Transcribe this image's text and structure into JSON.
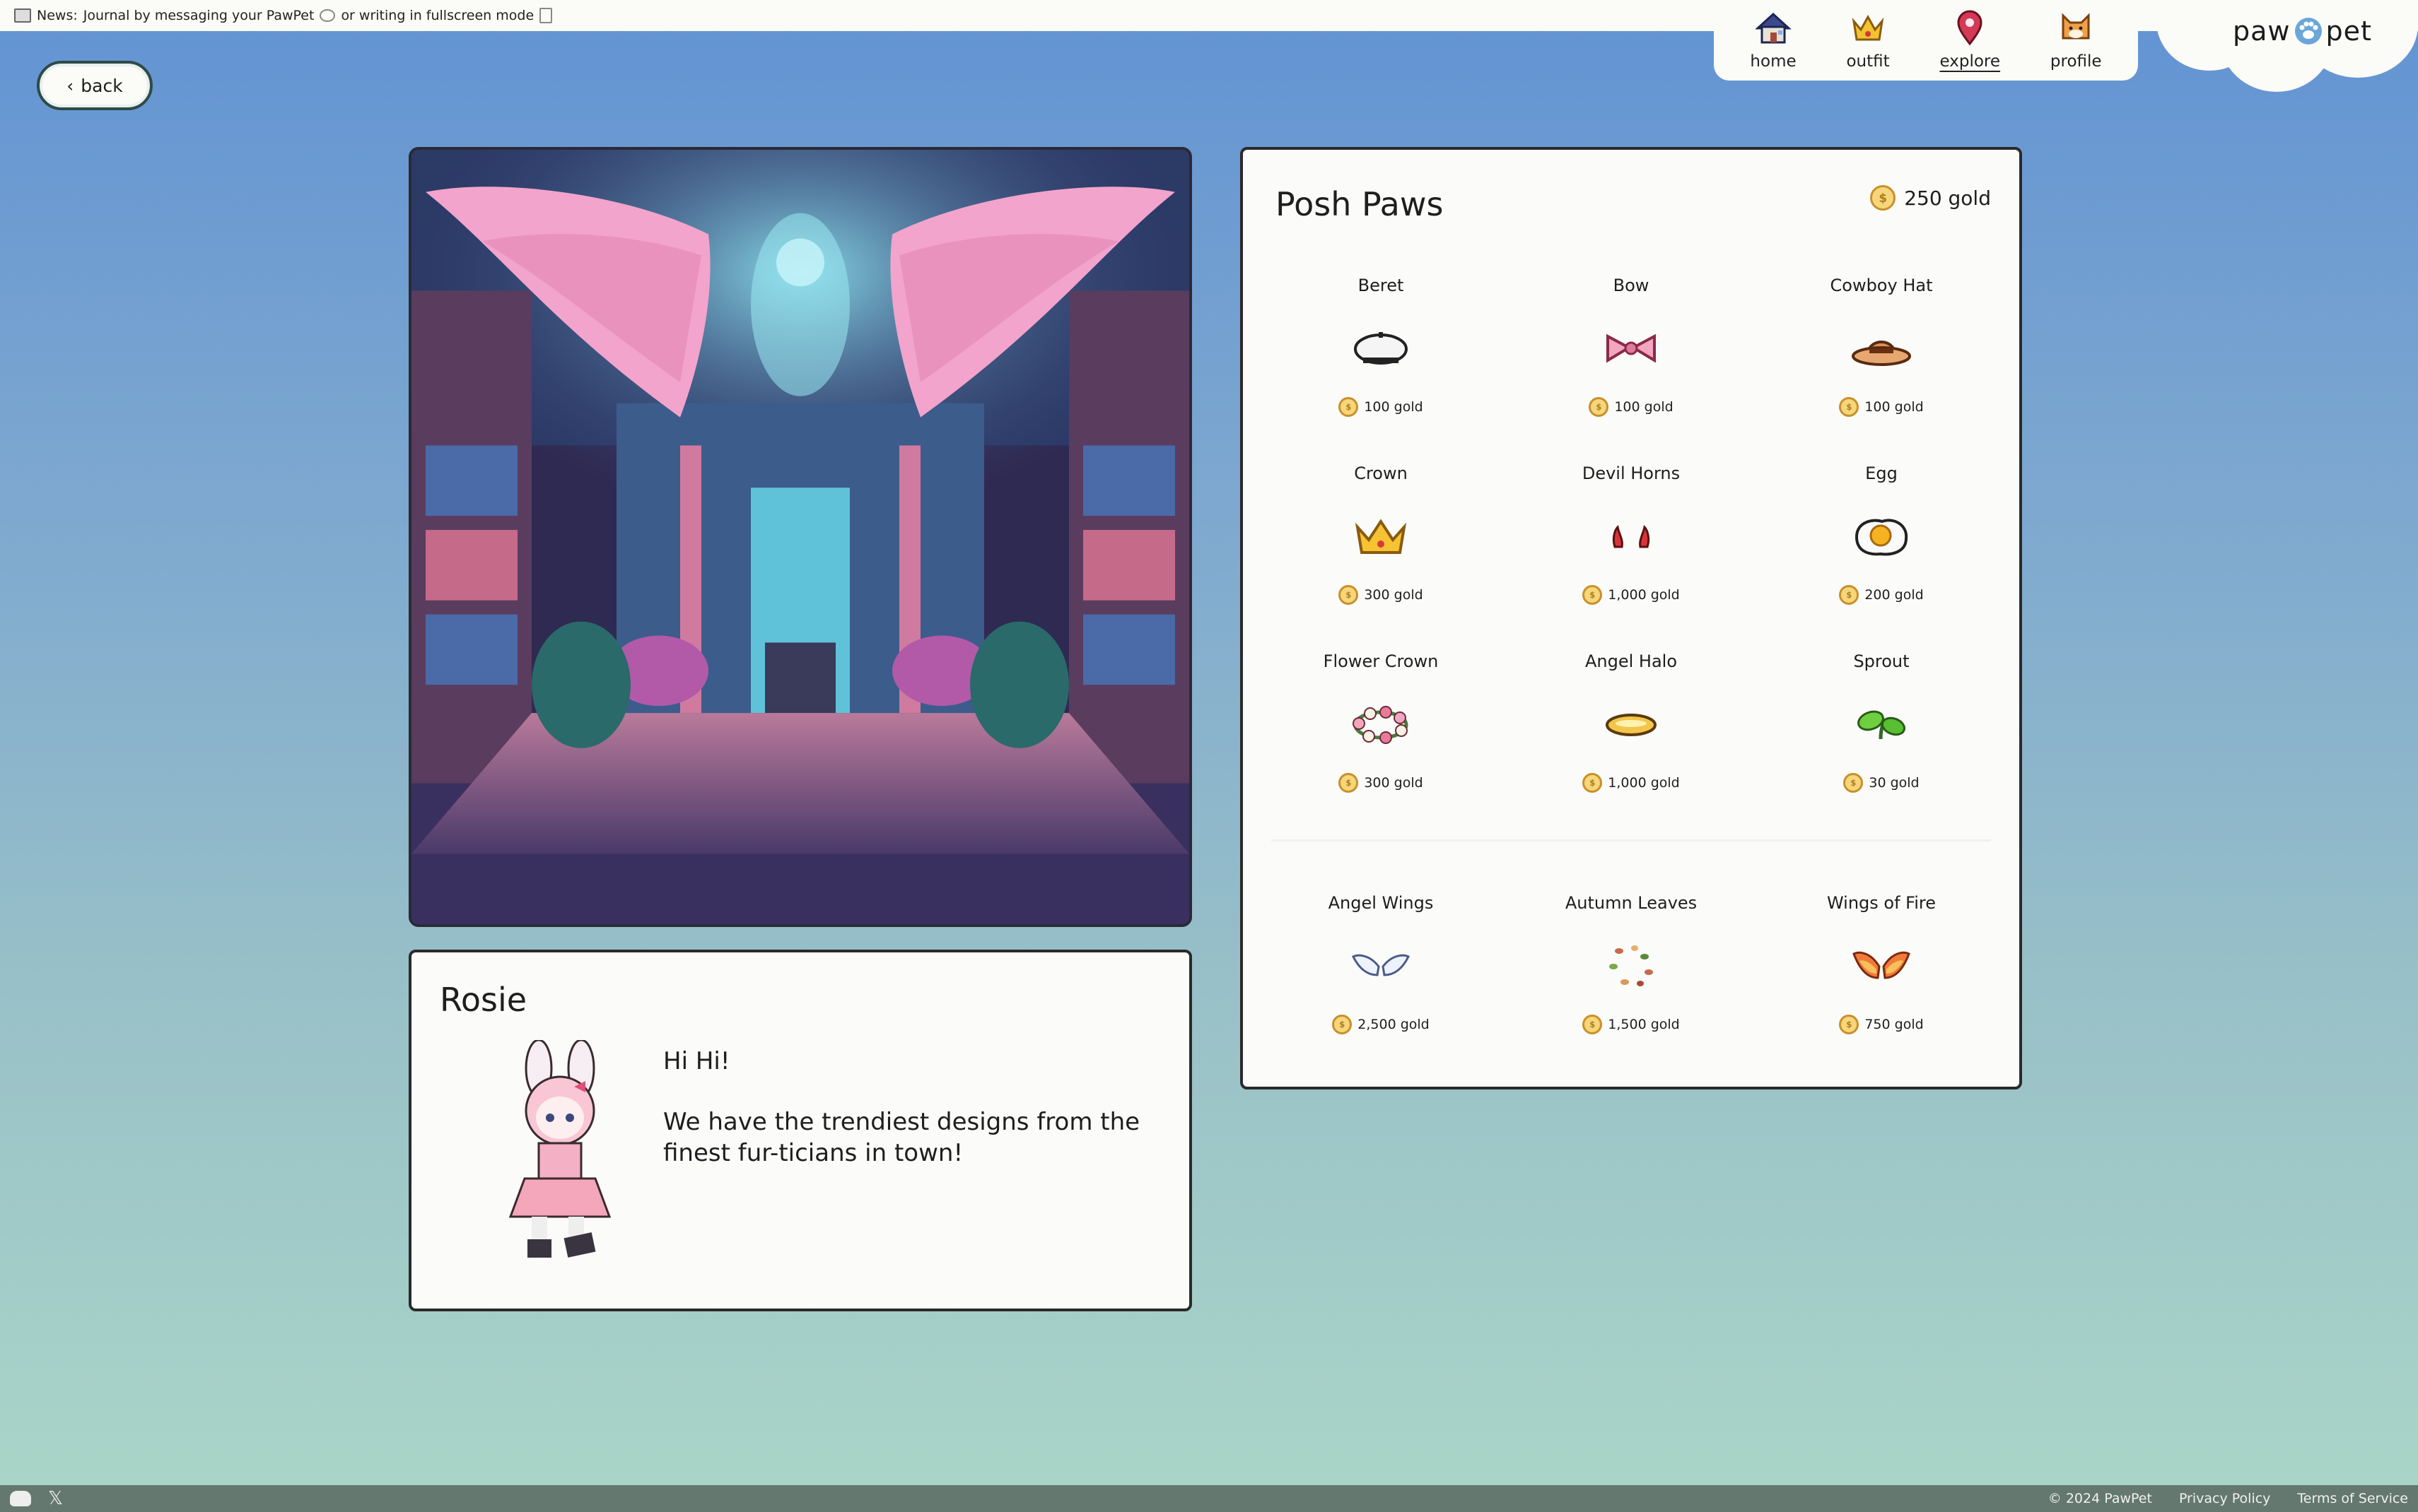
{
  "news": {
    "prefix": "News:",
    "text_before": "Journal by messaging your PawPet",
    "text_after": "or writing in fullscreen mode"
  },
  "nav": [
    {
      "label": "home",
      "icon": "house-icon"
    },
    {
      "label": "outfit",
      "icon": "crown-icon"
    },
    {
      "label": "explore",
      "icon": "map-pin-icon",
      "active": true
    },
    {
      "label": "profile",
      "icon": "cat-face-icon"
    }
  ],
  "logo": {
    "left": "paw",
    "right": "pet"
  },
  "back": {
    "label": "back"
  },
  "npc": {
    "name": "Rosie",
    "greeting": "Hi Hi!",
    "message": "We have the trendiest designs from the finest fur-ticians in town!"
  },
  "shop": {
    "title": "Posh Paws",
    "gold": "250 gold",
    "items": [
      {
        "name": "Beret",
        "price": "100 gold",
        "icon": "beret-icon"
      },
      {
        "name": "Bow",
        "price": "100 gold",
        "icon": "bow-icon"
      },
      {
        "name": "Cowboy Hat",
        "price": "100 gold",
        "icon": "cowboy-hat-icon"
      },
      {
        "name": "Crown",
        "price": "300 gold",
        "icon": "crown-icon"
      },
      {
        "name": "Devil Horns",
        "price": "1,000 gold",
        "icon": "devil-horns-icon"
      },
      {
        "name": "Egg",
        "price": "200 gold",
        "icon": "egg-icon"
      },
      {
        "name": "Flower Crown",
        "price": "300 gold",
        "icon": "flower-crown-icon"
      },
      {
        "name": "Angel Halo",
        "price": "1,000 gold",
        "icon": "halo-icon"
      },
      {
        "name": "Sprout",
        "price": "30 gold",
        "icon": "sprout-icon"
      }
    ],
    "back_items": [
      {
        "name": "Angel Wings",
        "price": "2,500 gold",
        "icon": "angel-wings-icon"
      },
      {
        "name": "Autumn Leaves",
        "price": "1,500 gold",
        "icon": "autumn-leaves-icon"
      },
      {
        "name": "Wings of Fire",
        "price": "750 gold",
        "icon": "fire-wings-icon"
      }
    ]
  },
  "footer": {
    "copyright": "© 2024 PawPet",
    "privacy": "Privacy Policy",
    "terms": "Terms of Service"
  },
  "colors": {
    "bg_top": "#6293d3",
    "bg_bottom": "#aad6c8",
    "panel": "#fbfbf9",
    "coin": "#f6d67a",
    "footer": "#64786f"
  }
}
